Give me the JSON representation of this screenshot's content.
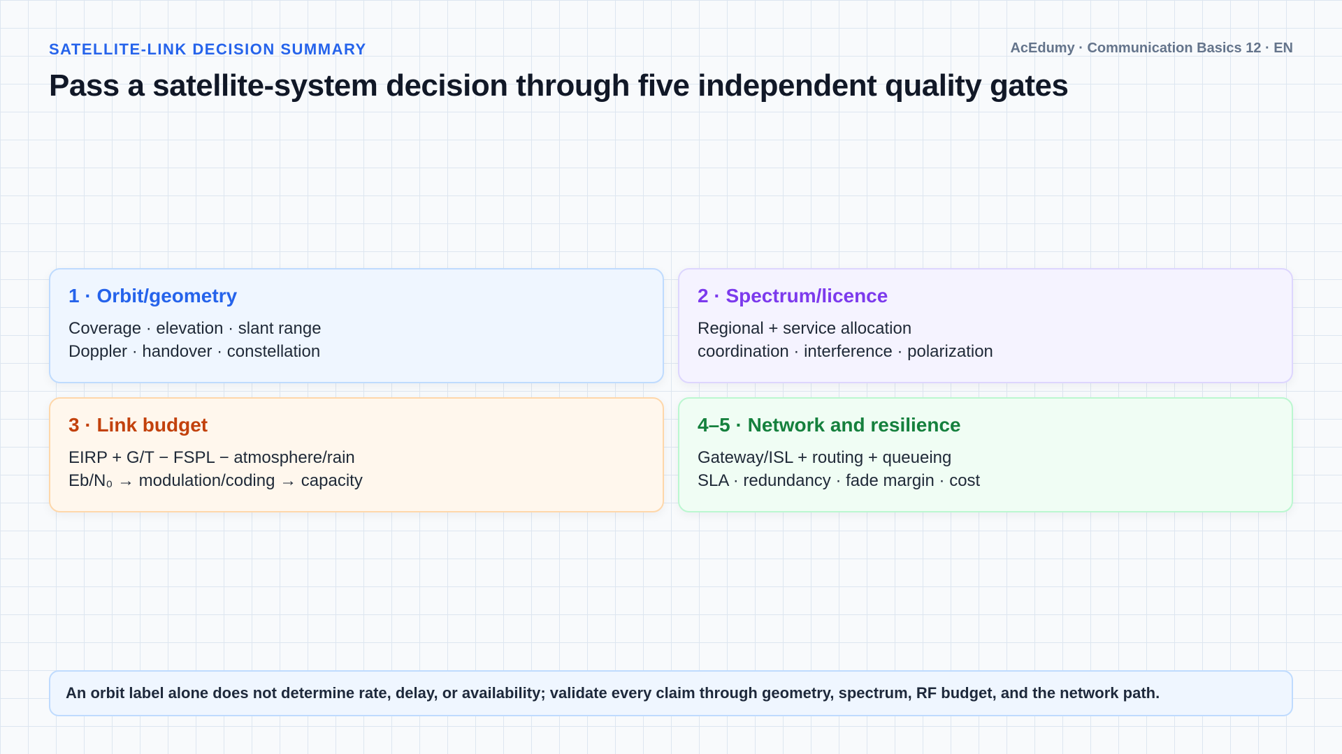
{
  "header": {
    "kicker": "SATELLITE-LINK DECISION SUMMARY",
    "meta": "AcEdumy · Communication Basics 12 · EN",
    "title": "Pass a satellite-system decision through five independent quality gates"
  },
  "cards": [
    {
      "title": "1 · Orbit/geometry",
      "line1": "Coverage · elevation · slant range",
      "line2": "Doppler · handover · constellation",
      "accent": "#2563eb",
      "bg": "#eff6ff",
      "border": "#bfdbfe"
    },
    {
      "title": "2 · Spectrum/licence",
      "line1": "Regional + service allocation",
      "line2": "coordination · interference · polarization",
      "accent": "#7c3aed",
      "bg": "#f5f3ff",
      "border": "#ddd6fe"
    },
    {
      "title": "3 · Link budget",
      "line1": "EIRP + G/T − FSPL − atmosphere/rain",
      "line2": "Eb/N₀ → modulation/coding → capacity",
      "accent": "#c2410c",
      "bg": "#fff7ed",
      "border": "#fed7aa"
    },
    {
      "title": "4–5 · Network and resilience",
      "line1": "Gateway/ISL + routing + queueing",
      "line2": "SLA · redundancy · fade margin · cost",
      "accent": "#15803d",
      "bg": "#f0fdf4",
      "border": "#bbf7d0"
    }
  ],
  "footer": {
    "text": "An orbit label alone does not determine rate, delay, or availability; validate every claim through geometry, spectrum, RF budget, and the network path."
  }
}
